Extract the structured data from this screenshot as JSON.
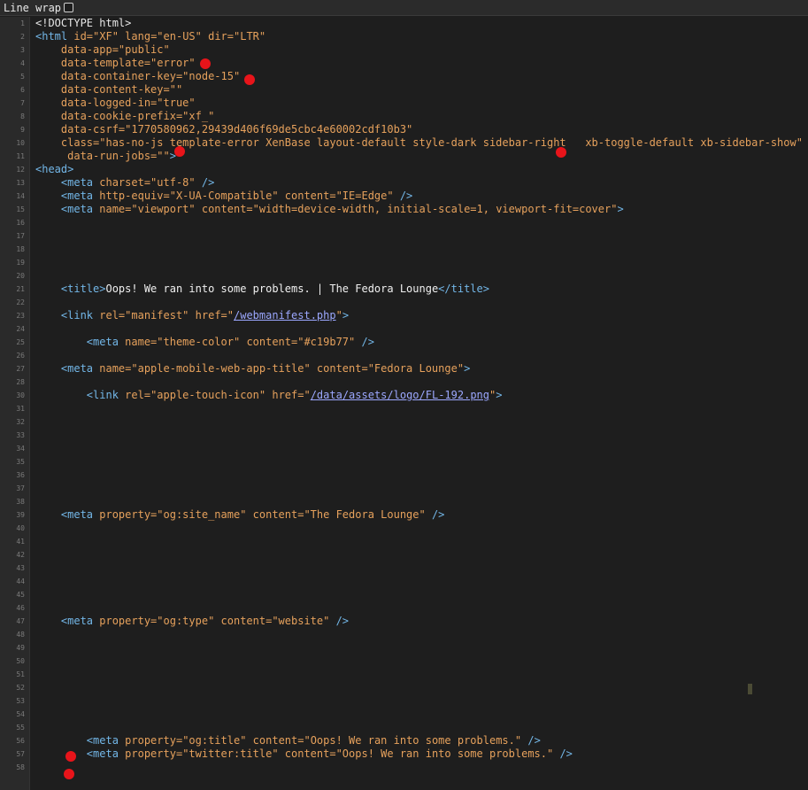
{
  "toolbar": {
    "wrap_label": "Line wrap",
    "wrap_checked": false
  },
  "lines": [
    {
      "n": "1",
      "parts": [
        [
          "doc",
          "<!DOCTYPE html>"
        ]
      ]
    },
    {
      "n": "2",
      "parts": [
        [
          "tag",
          "<html "
        ],
        [
          "attr",
          "id="
        ],
        [
          "val",
          "\"XF\" "
        ],
        [
          "attr",
          "lang="
        ],
        [
          "val",
          "\"en-US\" "
        ],
        [
          "attr",
          "dir="
        ],
        [
          "val",
          "\"LTR\""
        ]
      ]
    },
    {
      "n": "3",
      "parts": [
        [
          "attr",
          "    data-app="
        ],
        [
          "val",
          "\"public\""
        ]
      ]
    },
    {
      "n": "4",
      "parts": [
        [
          "attr",
          "    data-template="
        ],
        [
          "val",
          "\"error\""
        ]
      ]
    },
    {
      "n": "5",
      "parts": [
        [
          "attr",
          "    data-container-key="
        ],
        [
          "val",
          "\"node-15\""
        ]
      ]
    },
    {
      "n": "6",
      "parts": [
        [
          "attr",
          "    data-content-key="
        ],
        [
          "val",
          "\"\""
        ]
      ]
    },
    {
      "n": "7",
      "parts": [
        [
          "attr",
          "    data-logged-in="
        ],
        [
          "val",
          "\"true\""
        ]
      ]
    },
    {
      "n": "8",
      "parts": [
        [
          "attr",
          "    data-cookie-prefix="
        ],
        [
          "val",
          "\"xf_\""
        ]
      ]
    },
    {
      "n": "9",
      "parts": [
        [
          "attr",
          "    data-csrf="
        ],
        [
          "val",
          "\"1770580962,29439d406f69de5cbc4e60002cdf10b3\""
        ]
      ]
    },
    {
      "n": "10",
      "parts": [
        [
          "attr",
          "    class="
        ],
        [
          "val",
          "\"has-no-js template-error XenBase layout-default style-dark sidebar-right   xb-toggle-default xb-sidebar-show\""
        ]
      ]
    },
    {
      "n": "11",
      "parts": [
        [
          "attr",
          "     data-run-jobs="
        ],
        [
          "val",
          "\"\""
        ],
        [
          "tag",
          ">"
        ]
      ]
    },
    {
      "n": "12",
      "parts": [
        [
          "tag",
          "<head>"
        ]
      ]
    },
    {
      "n": "13",
      "parts": [
        [
          "tag",
          "    <meta "
        ],
        [
          "attr",
          "charset="
        ],
        [
          "val",
          "\"utf-8\" "
        ],
        [
          "tag",
          "/>"
        ]
      ]
    },
    {
      "n": "14",
      "parts": [
        [
          "tag",
          "    <meta "
        ],
        [
          "attr",
          "http-equiv="
        ],
        [
          "val",
          "\"X-UA-Compatible\" "
        ],
        [
          "attr",
          "content="
        ],
        [
          "val",
          "\"IE=Edge\" "
        ],
        [
          "tag",
          "/>"
        ]
      ]
    },
    {
      "n": "15",
      "parts": [
        [
          "tag",
          "    <meta "
        ],
        [
          "attr",
          "name="
        ],
        [
          "val",
          "\"viewport\" "
        ],
        [
          "attr",
          "content="
        ],
        [
          "val",
          "\"width=device-width, initial-scale=1, viewport-fit=cover\""
        ],
        [
          "tag",
          ">"
        ]
      ]
    },
    {
      "n": "16",
      "parts": []
    },
    {
      "n": "17",
      "parts": []
    },
    {
      "n": "18",
      "parts": []
    },
    {
      "n": "19",
      "parts": []
    },
    {
      "n": "20",
      "parts": []
    },
    {
      "n": "21",
      "parts": [
        [
          "tag",
          "    <title>"
        ],
        [
          "text",
          "Oops! We ran into some problems. | The Fedora Lounge"
        ],
        [
          "tag",
          "</title>"
        ]
      ]
    },
    {
      "n": "22",
      "parts": []
    },
    {
      "n": "23",
      "parts": [
        [
          "tag",
          "    <link "
        ],
        [
          "attr",
          "rel="
        ],
        [
          "val",
          "\"manifest\" "
        ],
        [
          "attr",
          "href="
        ],
        [
          "val",
          "\""
        ],
        [
          "link",
          "/webmanifest.php"
        ],
        [
          "val",
          "\""
        ],
        [
          "tag",
          ">"
        ]
      ]
    },
    {
      "n": "24",
      "parts": []
    },
    {
      "n": "25",
      "parts": [
        [
          "tag",
          "        <meta "
        ],
        [
          "attr",
          "name="
        ],
        [
          "val",
          "\"theme-color\" "
        ],
        [
          "attr",
          "content="
        ],
        [
          "val",
          "\"#c19b77\" "
        ],
        [
          "tag",
          "/>"
        ]
      ]
    },
    {
      "n": "26",
      "parts": []
    },
    {
      "n": "27",
      "parts": [
        [
          "tag",
          "    <meta "
        ],
        [
          "attr",
          "name="
        ],
        [
          "val",
          "\"apple-mobile-web-app-title\" "
        ],
        [
          "attr",
          "content="
        ],
        [
          "val",
          "\"Fedora Lounge\""
        ],
        [
          "tag",
          ">"
        ]
      ]
    },
    {
      "n": "28",
      "parts": []
    },
    {
      "n": "30",
      "parts": [
        [
          "tag",
          "        <link "
        ],
        [
          "attr",
          "rel="
        ],
        [
          "val",
          "\"apple-touch-icon\" "
        ],
        [
          "attr",
          "href="
        ],
        [
          "val",
          "\""
        ],
        [
          "link",
          "/data/assets/logo/FL-192.png"
        ],
        [
          "val",
          "\""
        ],
        [
          "tag",
          ">"
        ]
      ]
    },
    {
      "n": "31",
      "parts": []
    },
    {
      "n": "32",
      "parts": []
    },
    {
      "n": "33",
      "parts": []
    },
    {
      "n": "34",
      "parts": []
    },
    {
      "n": "35",
      "parts": []
    },
    {
      "n": "36",
      "parts": []
    },
    {
      "n": "37",
      "parts": []
    },
    {
      "n": "38",
      "parts": []
    },
    {
      "n": "39",
      "parts": [
        [
          "tag",
          "    <meta "
        ],
        [
          "attr",
          "property="
        ],
        [
          "val",
          "\"og:site_name\" "
        ],
        [
          "attr",
          "content="
        ],
        [
          "val",
          "\"The Fedora Lounge\" "
        ],
        [
          "tag",
          "/>"
        ]
      ]
    },
    {
      "n": "40",
      "parts": []
    },
    {
      "n": "41",
      "parts": []
    },
    {
      "n": "42",
      "parts": []
    },
    {
      "n": "43",
      "parts": []
    },
    {
      "n": "44",
      "parts": []
    },
    {
      "n": "45",
      "parts": []
    },
    {
      "n": "46",
      "parts": []
    },
    {
      "n": "47",
      "parts": [
        [
          "tag",
          "    <meta "
        ],
        [
          "attr",
          "property="
        ],
        [
          "val",
          "\"og:type\" "
        ],
        [
          "attr",
          "content="
        ],
        [
          "val",
          "\"website\" "
        ],
        [
          "tag",
          "/>"
        ]
      ]
    },
    {
      "n": "48",
      "parts": []
    },
    {
      "n": "49",
      "parts": []
    },
    {
      "n": "50",
      "parts": []
    },
    {
      "n": "51",
      "parts": []
    },
    {
      "n": "52",
      "parts": []
    },
    {
      "n": "53",
      "parts": []
    },
    {
      "n": "54",
      "parts": []
    },
    {
      "n": "55",
      "parts": []
    },
    {
      "n": "56",
      "parts": [
        [
          "tag",
          "        <meta "
        ],
        [
          "attr",
          "property="
        ],
        [
          "val",
          "\"og:title\" "
        ],
        [
          "attr",
          "content="
        ],
        [
          "val",
          "\"Oops! We ran into some problems.\" "
        ],
        [
          "tag",
          "/>"
        ]
      ]
    },
    {
      "n": "57",
      "parts": [
        [
          "tag",
          "        <meta "
        ],
        [
          "attr",
          "property="
        ],
        [
          "val",
          "\"twitter:title\" "
        ],
        [
          "attr",
          "content="
        ],
        [
          "val",
          "\"Oops! We ran into some problems.\" "
        ],
        [
          "tag",
          "/>"
        ]
      ]
    },
    {
      "n": "58",
      "parts": []
    }
  ],
  "annotations": {
    "color": "#e8141a"
  }
}
